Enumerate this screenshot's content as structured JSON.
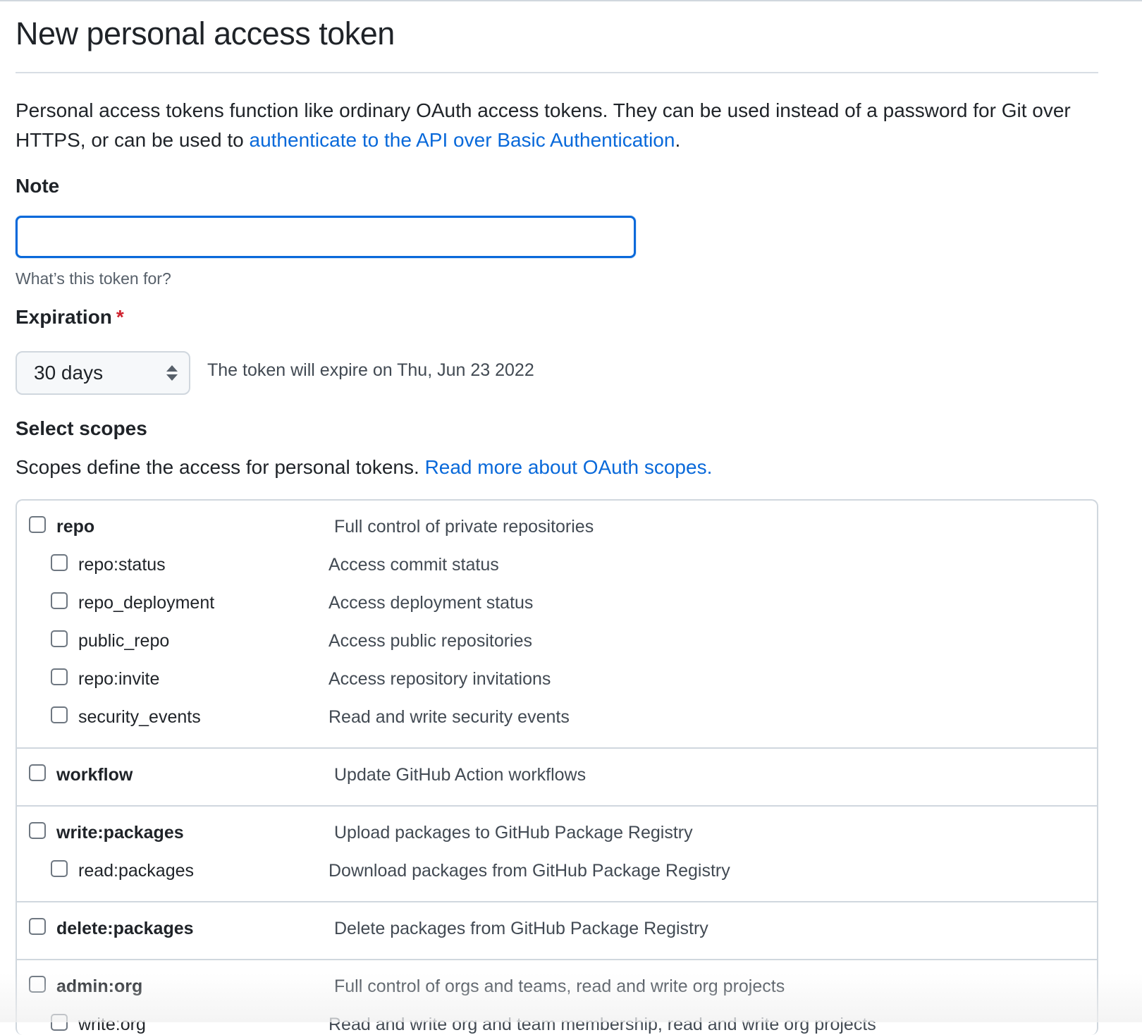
{
  "header": {
    "title": "New personal access token"
  },
  "intro": {
    "text_before": "Personal access tokens function like ordinary OAuth access tokens. They can be used instead of a password for Git over HTTPS, or can be used to ",
    "link_text": "authenticate to the API over Basic Authentication",
    "text_after": "."
  },
  "note": {
    "label": "Note",
    "value": "",
    "hint": "What’s this token for?"
  },
  "expiration": {
    "label": "Expiration",
    "required_mark": "*",
    "selected": "30 days",
    "info": "The token will expire on Thu, Jun 23 2022"
  },
  "scopes": {
    "label": "Select scopes",
    "description": "Scopes define the access for personal tokens. ",
    "link_text": "Read more about OAuth scopes.",
    "groups": [
      {
        "name": "repo",
        "desc": "Full control of private repositories",
        "children": [
          {
            "name": "repo:status",
            "desc": "Access commit status"
          },
          {
            "name": "repo_deployment",
            "desc": "Access deployment status"
          },
          {
            "name": "public_repo",
            "desc": "Access public repositories"
          },
          {
            "name": "repo:invite",
            "desc": "Access repository invitations"
          },
          {
            "name": "security_events",
            "desc": "Read and write security events"
          }
        ]
      },
      {
        "name": "workflow",
        "desc": "Update GitHub Action workflows",
        "children": []
      },
      {
        "name": "write:packages",
        "desc": "Upload packages to GitHub Package Registry",
        "children": [
          {
            "name": "read:packages",
            "desc": "Download packages from GitHub Package Registry"
          }
        ]
      },
      {
        "name": "delete:packages",
        "desc": "Delete packages from GitHub Package Registry",
        "children": []
      },
      {
        "name": "admin:org",
        "desc": "Full control of orgs and teams, read and write org projects",
        "children": [
          {
            "name": "write:org",
            "desc": "Read and write org and team membership, read and write org projects"
          }
        ]
      }
    ]
  }
}
